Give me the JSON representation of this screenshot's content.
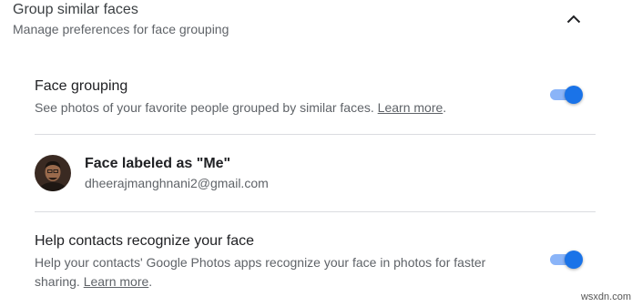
{
  "section": {
    "title": "Group similar faces",
    "subtitle": "Manage preferences for face grouping",
    "collapse_icon": "chevron-up-icon"
  },
  "face_grouping": {
    "title": "Face grouping",
    "description": "See photos of your favorite people grouped by similar faces.",
    "link": "Learn more",
    "after_link": ".",
    "enabled": true
  },
  "face_labeled": {
    "title": "Face labeled as \"Me\"",
    "email": "dheerajmanghnani2@gmail.com",
    "avatar_icon": "user-avatar"
  },
  "help_contacts": {
    "title": "Help contacts recognize your face",
    "description": "Help your contacts' Google Photos apps recognize your face in photos for faster sharing.",
    "link": "Learn more",
    "after_link": ".",
    "enabled": true
  },
  "watermark": "wsxdn.com",
  "colors": {
    "toggle_thumb": "#1a73e8",
    "toggle_track": "#8ab4f8",
    "divider": "#dadce0",
    "secondary_text": "#5f6368"
  }
}
